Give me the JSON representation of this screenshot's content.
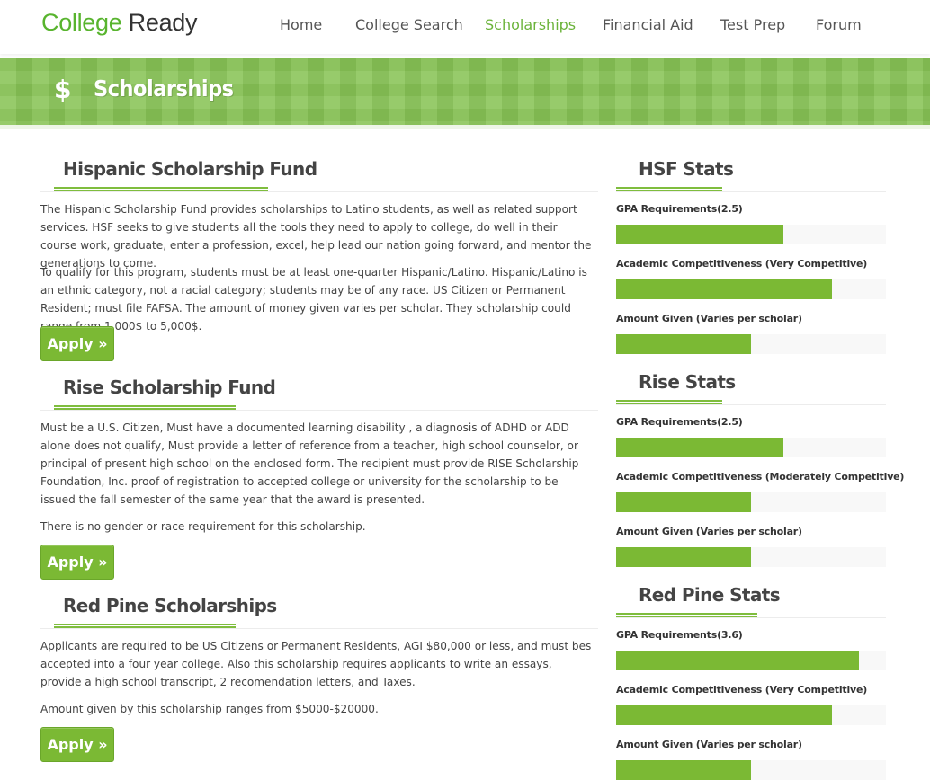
{
  "header": {
    "logo_part1": "College",
    "logo_part2": "Ready",
    "nav": [
      "Home",
      "College Search",
      "Scholarships",
      "Financial Aid",
      "Test Prep",
      "Forum"
    ],
    "active_nav": "Scholarships"
  },
  "banner": {
    "icon": "dollar-icon",
    "icon_glyph": "$",
    "title": "Scholarships"
  },
  "scholarships": [
    {
      "title": "Hispanic Scholarship Fund",
      "paragraphs": [
        "The Hispanic Scholarship Fund provides scholarships to Latino students, as well as related support services. HSF seeks to give students all the tools they need to apply to college, do well in their course work, graduate, enter a profession, excel, help lead our nation going forward, and mentor the generations to come.",
        "To qualify for this program, students must be at least one-quarter Hispanic/Latino. Hispanic/Latino is an ethnic category, not a racial category; students may be of any race. US Citizen or Permanent Resident; must file FAFSA. The amount of money given varies per scholar. They scholarship could range from 1,000$ to 5,000$."
      ],
      "apply_label": "Apply »"
    },
    {
      "title": "Rise Scholarship Fund",
      "paragraphs": [
        "Must be a U.S. Citizen, Must have a documented learning disability , a diagnosis of ADHD or ADD alone does not qualify, Must provide a letter of reference from a teacher, high school counselor, or principal of present high school on the enclosed form. The recipient must provide RISE Scholarship Foundation, Inc. proof of registration to accepted college or university for the scholarship to be issued the fall semester of the same year that the award is presented.",
        "There is no gender or race requirement for this scholarship."
      ],
      "apply_label": "Apply »"
    },
    {
      "title": "Red Pine Scholarships",
      "paragraphs": [
        "Applicants are required to be US Citizens or Permanent Residents, AGI $80,000 or less, and must bes accepted into a four year college. Also this scholarship requires applicants to write an essays, provide a high school transcript, 2 recomendation letters, and Taxes.",
        "Amount given by this scholarship ranges from $5000-$20000."
      ],
      "apply_label": "Apply »"
    }
  ],
  "stats": [
    {
      "title": "HSF Stats",
      "items": [
        {
          "label": "GPA Requirements(2.5)",
          "fill_fraction": 0.62
        },
        {
          "label": "Academic Competitiveness (Very Competitive)",
          "fill_fraction": 0.8
        },
        {
          "label": "Amount Given (Varies per scholar)",
          "fill_fraction": 0.5
        }
      ]
    },
    {
      "title": "Rise Stats",
      "items": [
        {
          "label": "GPA Requirements(2.5)",
          "fill_fraction": 0.62
        },
        {
          "label": "Academic Competitiveness (Moderately Competitive)",
          "fill_fraction": 0.5
        },
        {
          "label": "Amount Given (Varies per scholar)",
          "fill_fraction": 0.5
        }
      ]
    },
    {
      "title": "Red Pine Stats",
      "items": [
        {
          "label": "GPA Requirements(3.6)",
          "fill_fraction": 0.9
        },
        {
          "label": "Academic Competitiveness (Very Competitive)",
          "fill_fraction": 0.8
        },
        {
          "label": "Amount Given (Varies per scholar)",
          "fill_fraction": 0.5
        }
      ]
    }
  ],
  "colors": {
    "accent": "#7bb934",
    "banner": "#88c456",
    "logo_green": "#58b42e",
    "nav_active": "#6bb33a"
  }
}
